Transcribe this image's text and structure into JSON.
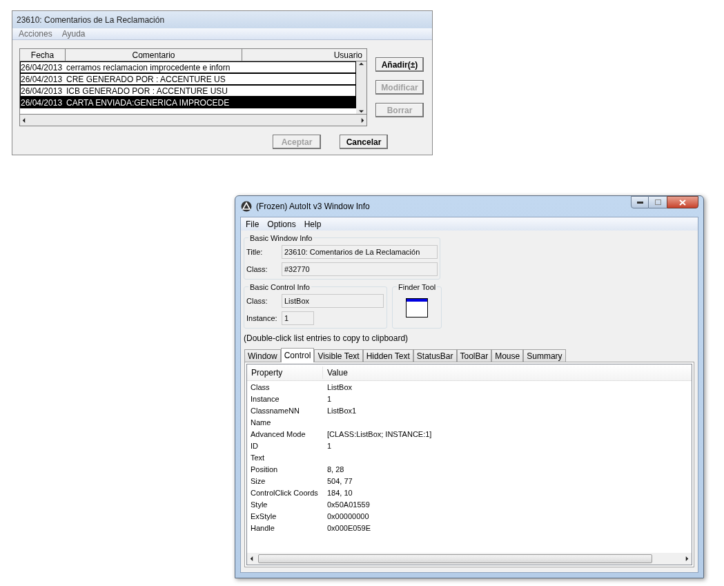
{
  "dialog": {
    "title": "23610: Comentarios de La Reclamación",
    "menu": [
      "Acciones",
      "Ayuda"
    ],
    "columns": [
      "Fecha",
      "Comentario",
      "Usuario"
    ],
    "rows": [
      {
        "date": "26/04/2013",
        "comment": "cerramos reclamacion improcedente e inforn",
        "user": "",
        "selected": false
      },
      {
        "date": "26/04/2013",
        "comment": "CRE  GENERADO POR : ACCENTURE US",
        "user": "",
        "selected": false
      },
      {
        "date": "26/04/2013",
        "comment": "ICB  GENERADO POR : ACCENTURE USU",
        "user": "",
        "selected": false
      },
      {
        "date": "26/04/2013",
        "comment": "CARTA ENVIADA:GENERICA IMPROCEDE",
        "user": "",
        "selected": true
      }
    ],
    "side_buttons": [
      {
        "label": "Añadir(±)",
        "disabled": false
      },
      {
        "label": "Modificar",
        "disabled": true
      },
      {
        "label": "Borrar",
        "disabled": true
      }
    ],
    "bottom_buttons": [
      {
        "label": "Aceptar",
        "disabled": true
      },
      {
        "label": "Cancelar",
        "disabled": false
      }
    ]
  },
  "info": {
    "title": "(Frozen) AutoIt v3 Window Info",
    "menu": [
      "File",
      "Options",
      "Help"
    ],
    "basic_window": {
      "legend": "Basic Window Info",
      "fields": [
        {
          "label": "Title:",
          "value": "23610: Comentarios de La Reclamación"
        },
        {
          "label": "Class:",
          "value": "#32770"
        }
      ]
    },
    "basic_control": {
      "legend": "Basic Control Info",
      "fields": [
        {
          "label": "Class:",
          "value": "ListBox"
        },
        {
          "label": "Instance:",
          "value": "1"
        }
      ]
    },
    "finder": {
      "legend": "Finder Tool"
    },
    "hint": "(Double-click list entries to copy to clipboard)",
    "tabs": [
      {
        "label": "Window",
        "selected": false
      },
      {
        "label": "Control",
        "selected": true
      },
      {
        "label": "Visible Text",
        "selected": false
      },
      {
        "label": "Hidden Text",
        "selected": false
      },
      {
        "label": "StatusBar",
        "selected": false
      },
      {
        "label": "ToolBar",
        "selected": false
      },
      {
        "label": "Mouse",
        "selected": false
      },
      {
        "label": "Summary",
        "selected": false
      }
    ],
    "columns": [
      "Property",
      "Value"
    ],
    "rows": [
      {
        "property": "Class",
        "value": "ListBox"
      },
      {
        "property": "Instance",
        "value": "1"
      },
      {
        "property": "ClassnameNN",
        "value": "ListBox1"
      },
      {
        "property": "Name",
        "value": ""
      },
      {
        "property": "Advanced Mode",
        "value": "[CLASS:ListBox; INSTANCE:1]"
      },
      {
        "property": "ID",
        "value": "1"
      },
      {
        "property": "Text",
        "value": ""
      },
      {
        "property": "Position",
        "value": "8, 28"
      },
      {
        "property": "Size",
        "value": "504, 77"
      },
      {
        "property": "ControlClick Coords",
        "value": "184, 10"
      },
      {
        "property": "Style",
        "value": "0x50A01559"
      },
      {
        "property": "ExStyle",
        "value": "0x00000000"
      },
      {
        "property": "Handle",
        "value": "0x000E059E"
      }
    ]
  }
}
